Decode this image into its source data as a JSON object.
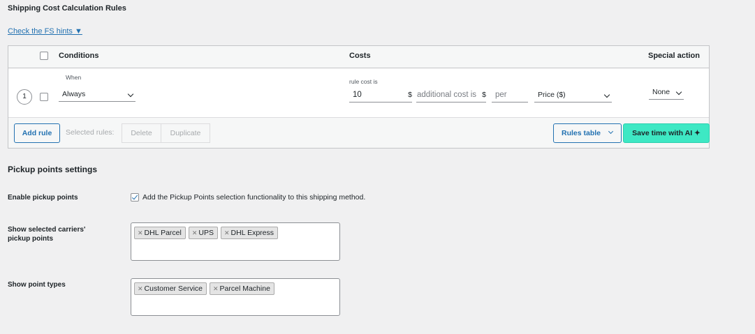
{
  "shipping_rules": {
    "title": "Shipping Cost Calculation Rules",
    "hints_link": "Check the FS hints ▼",
    "headers": {
      "conditions": "Conditions",
      "costs": "Costs",
      "special_action": "Special action"
    },
    "rule": {
      "number": "1",
      "when_label": "When",
      "condition_value": "Always",
      "rule_cost_label": "rule cost is",
      "rule_cost_value": "10",
      "currency": "$",
      "additional_cost_placeholder": "additional cost is",
      "additional_currency": "$",
      "per_placeholder": "per",
      "per_select_value": "Price ($)",
      "special_action_value": "None"
    },
    "footer": {
      "add_rule": "Add rule",
      "selected_rules_label": "Selected rules:",
      "delete": "Delete",
      "duplicate": "Duplicate",
      "rules_table": "Rules table",
      "save_time": "Save time with AI ✦"
    }
  },
  "pickup": {
    "title": "Pickup points settings",
    "enable_label": "Enable pickup points",
    "enable_checked": true,
    "enable_description": "Add the Pickup Points selection functionality to this shipping method.",
    "carriers_label_line1": "Show selected carriers'",
    "carriers_label_line2": "pickup points",
    "carriers": [
      "DHL Parcel",
      "UPS",
      "DHL Express"
    ],
    "point_types_label": "Show point types",
    "point_types": [
      "Customer Service",
      "Parcel Machine"
    ]
  },
  "colors": {
    "link": "#2271b1",
    "ai_button": "#3ee8c4",
    "background": "#f0f0f1"
  }
}
